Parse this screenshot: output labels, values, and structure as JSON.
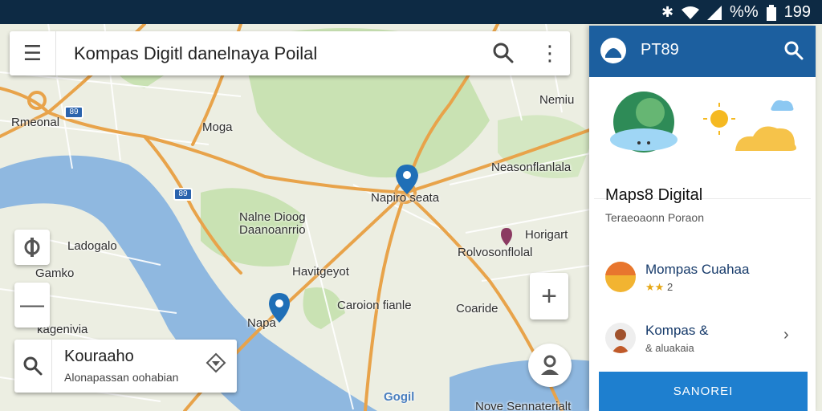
{
  "status_bar": {
    "icons": [
      "bluetooth-icon",
      "wifi-icon",
      "signal-icon",
      "battery-icon"
    ],
    "percent": "%%",
    "time": "199"
  },
  "search_bar": {
    "query": "Kompas Digitl danelnaya Poilal"
  },
  "map": {
    "labels": [
      "Rmeonal",
      "Moga",
      "Ladogalo",
      "Gamko",
      "kagenivia",
      "Nalne Dioog",
      "Daanoanrrio",
      "Havitgeyot",
      "Napa",
      "Caroion fianle",
      "Coaride",
      "Rolvosonflolal",
      "Horigart",
      "Neasonflanlala",
      "Nemiu",
      "Nove Sennaterialt",
      "Napiro seata"
    ],
    "highways": [
      "89",
      "89"
    ],
    "attribution": "Gogil"
  },
  "bottom_card": {
    "title": "Kouraaho",
    "subtitle": "Alonapassan oohabian"
  },
  "side_panel": {
    "header_title": "PT89",
    "place_title": "Maps8 Digital",
    "place_subtitle": "Teraeoaonn Poraon",
    "items": [
      {
        "name": "Mompas Cuahaa",
        "meta": "2"
      },
      {
        "name": "Kompas &",
        "meta": "& aluakaia"
      }
    ],
    "cta_label": "SANOREI"
  },
  "colors": {
    "status_bar": "#0d2a44",
    "panel_header": "#1c5f9f",
    "cta": "#1e7fcf",
    "water": "#8fb8e0",
    "park": "#c9e2b3",
    "road": "#e8a34a",
    "pin": "#1f6fb7"
  }
}
